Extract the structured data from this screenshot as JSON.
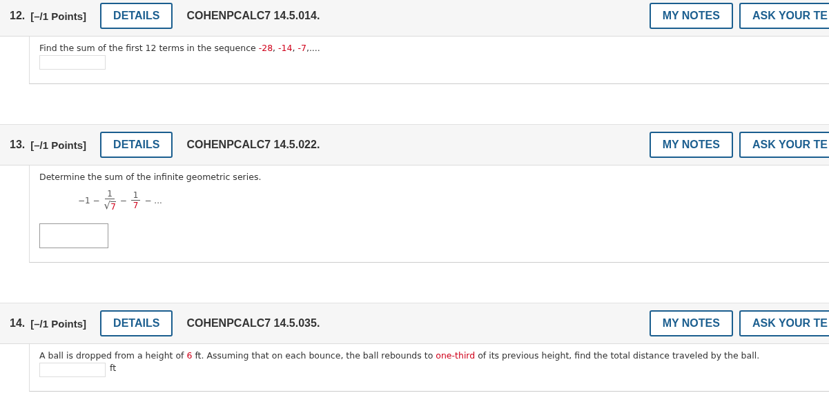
{
  "questions": [
    {
      "number": "12.",
      "points": "[–/1 Points]",
      "details_button": "DETAILS",
      "code": "COHENPCALC7 14.5.014.",
      "notes_button": "MY NOTES",
      "ask_button": "ASK YOUR TE",
      "prompt": [
        {
          "text": "Find the sum of the first 12 terms in the sequence ",
          "highlight": false
        },
        {
          "text": "-28",
          "highlight": true
        },
        {
          "text": ", ",
          "highlight": false
        },
        {
          "text": "-14",
          "highlight": true
        },
        {
          "text": ", ",
          "highlight": false
        },
        {
          "text": "-7",
          "highlight": true
        },
        {
          "text": ",....",
          "highlight": false
        }
      ],
      "answer": {
        "kind": "inline"
      }
    },
    {
      "number": "13.",
      "points": "[–/1 Points]",
      "details_button": "DETAILS",
      "code": "COHENPCALC7 14.5.022.",
      "notes_button": "MY NOTES",
      "ask_button": "ASK YOUR TE",
      "prompt": [
        {
          "text": "Determine the sum of the infinite geometric series.",
          "highlight": false
        }
      ],
      "math": [
        {
          "kind": "text",
          "text": "−1 −"
        },
        {
          "kind": "frac",
          "numerator": "1",
          "radical": "√",
          "denominator": "7",
          "highlight": true
        },
        {
          "kind": "text",
          "text": "−"
        },
        {
          "kind": "frac",
          "numerator": "1",
          "denominator": "7",
          "highlight": true
        },
        {
          "kind": "text",
          "text": "− ..."
        }
      ],
      "answer": {
        "kind": "boxed"
      }
    },
    {
      "number": "14.",
      "points": "[–/1 Points]",
      "details_button": "DETAILS",
      "code": "COHENPCALC7 14.5.035.",
      "notes_button": "MY NOTES",
      "ask_button": "ASK YOUR TE",
      "prompt": [
        {
          "text": "A ball is dropped from a height of ",
          "highlight": false
        },
        {
          "text": "6",
          "highlight": true
        },
        {
          "text": " ft. Assuming that on each bounce, the ball rebounds to ",
          "highlight": false
        },
        {
          "text": "one-third",
          "highlight": true
        },
        {
          "text": " of its previous height, find the total distance traveled by the ball.",
          "highlight": false
        }
      ],
      "answer": {
        "kind": "inline",
        "unit": "ft"
      }
    }
  ]
}
